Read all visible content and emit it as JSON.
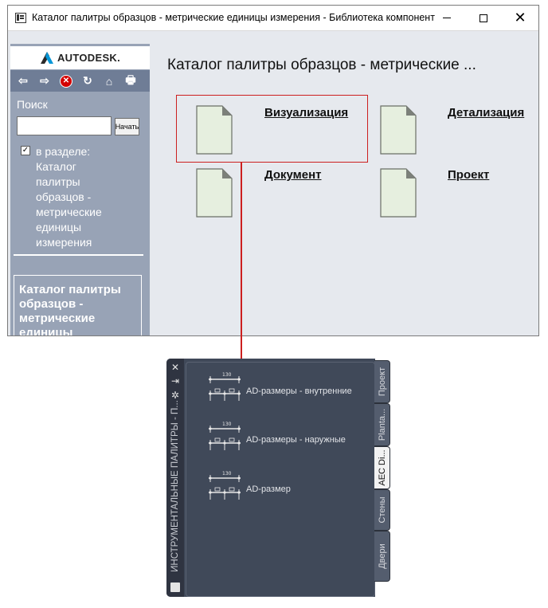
{
  "window": {
    "title": "Каталог палитры образцов - метрические единицы измерения - Библиотека компонент",
    "minimize_icon": "minimize-icon",
    "maximize_icon": "maximize-icon",
    "close_icon": "close-icon",
    "close_glyph": "✕"
  },
  "sidebar": {
    "logo_text": "AUTODESK.",
    "nav": [
      {
        "name": "back-icon",
        "glyph": "⇦"
      },
      {
        "name": "forward-icon",
        "glyph": "⇨"
      },
      {
        "name": "stop-icon",
        "glyph": "✕"
      },
      {
        "name": "refresh-icon",
        "glyph": "↻"
      },
      {
        "name": "home-icon",
        "glyph": "⌂"
      },
      {
        "name": "print-icon",
        "glyph": "🖶"
      }
    ],
    "search_label": "Поиск",
    "search_value": "",
    "search_button": "Начать",
    "scope_checked": "✓",
    "scope_text": "в разделе: Каталог палитры образцов - метрические единицы измерения",
    "current_text": "Каталог палитры образцов - метрические единицы"
  },
  "content": {
    "title": "Каталог палитры образцов - метрические ...",
    "items": [
      {
        "label": "Визуализация"
      },
      {
        "label": "Детализация"
      },
      {
        "label": "Документ"
      },
      {
        "label": "Проект"
      }
    ]
  },
  "palette": {
    "title": "ИНСТРУМЕНТАЛЬНЫЕ ПАЛИТРЫ - П...",
    "strip_icons": [
      {
        "name": "close-icon",
        "glyph": "✕"
      },
      {
        "name": "autohide-icon",
        "glyph": "⇥"
      },
      {
        "name": "settings-icon",
        "glyph": "✲"
      }
    ],
    "properties_icon": "properties-icon",
    "dimension_text": "130",
    "tools": [
      {
        "label": "AD-размеры - внутренние"
      },
      {
        "label": "AD-размеры - наружные"
      },
      {
        "label": "AD-размер"
      }
    ],
    "tabs": [
      {
        "label": "Проект",
        "active": false
      },
      {
        "label": "Planta...",
        "active": false
      },
      {
        "label": "AEC Di...",
        "active": true
      },
      {
        "label": "Стены",
        "active": false
      },
      {
        "label": "Двери",
        "active": false
      }
    ]
  },
  "colors": {
    "highlight": "#cc1f1f",
    "sidebar_bg": "#98a3b6",
    "content_bg": "#e6e9ee",
    "palette_bg": "#404959"
  }
}
